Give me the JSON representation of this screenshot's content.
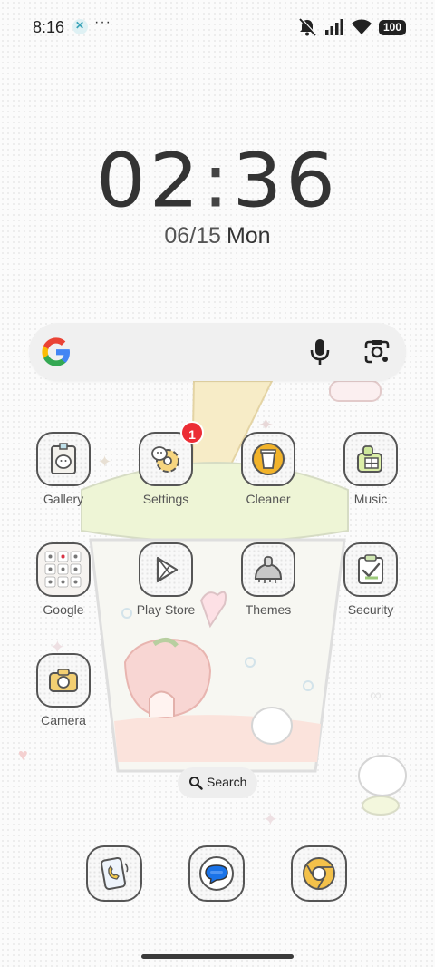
{
  "status_bar": {
    "time": "8:16",
    "overflow": "···",
    "battery": "100",
    "icons": [
      "app-notification-icon",
      "mute-icon",
      "signal-icon",
      "wifi-icon",
      "battery-icon"
    ]
  },
  "clock": {
    "hours": "02",
    "minutes": "36",
    "colon": ":"
  },
  "date": {
    "date": "06/15",
    "weekday": "Mon"
  },
  "search_widget": {
    "icons": [
      "google-logo-icon",
      "mic-icon",
      "lens-icon"
    ]
  },
  "apps": [
    {
      "label": "Gallery",
      "icon": "gallery-icon"
    },
    {
      "label": "Settings",
      "icon": "settings-icon",
      "badge": "1"
    },
    {
      "label": "Cleaner",
      "icon": "cleaner-icon"
    },
    {
      "label": "Music",
      "icon": "music-icon"
    },
    {
      "label": "Google",
      "icon": "google-folder-icon"
    },
    {
      "label": "Play Store",
      "icon": "play-store-icon"
    },
    {
      "label": "Themes",
      "icon": "themes-icon"
    },
    {
      "label": "Security",
      "icon": "security-icon"
    },
    {
      "label": "Camera",
      "icon": "camera-icon"
    }
  ],
  "bottom_search": {
    "label": "Search"
  },
  "dock": [
    {
      "icon": "phone-icon"
    },
    {
      "icon": "messages-icon"
    },
    {
      "icon": "chrome-icon"
    }
  ],
  "colors": {
    "badge": "#ec2d35",
    "icon_outline": "#555555",
    "accent_yellow": "#f2b32a"
  }
}
